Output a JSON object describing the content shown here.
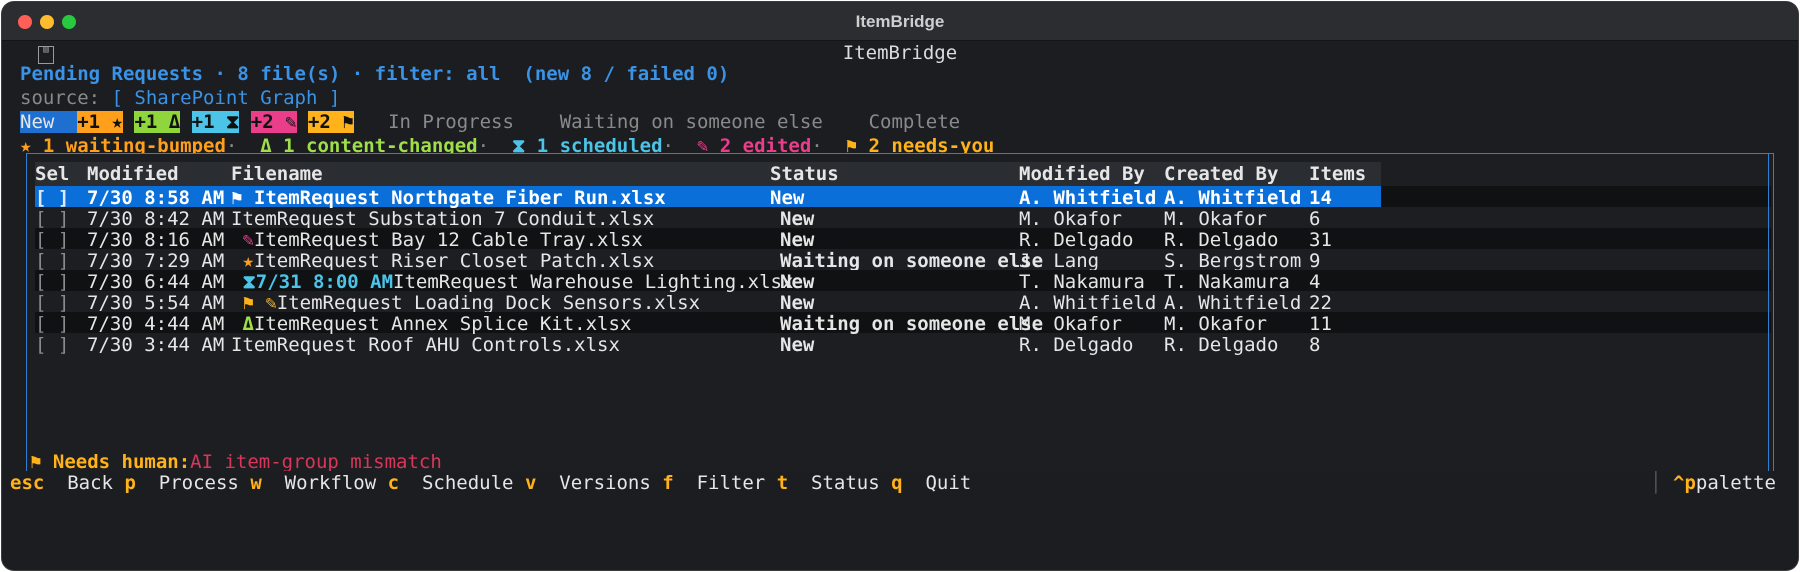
{
  "window": {
    "title": "ItemBridge"
  },
  "app": {
    "title": "ItemBridge",
    "header": {
      "title": "Pending Requests",
      "file_count": "8 file(s)",
      "filter": "filter: all",
      "counts": "(new 8 / failed 0)",
      "source_label": "source:",
      "source_value": "[ SharePoint Graph ]"
    },
    "tabs": {
      "new": "New",
      "chips": [
        {
          "label": "+1 ★",
          "color": "orange"
        },
        {
          "label": "+1 Δ",
          "color": "green"
        },
        {
          "label": "+1 ⧗",
          "color": "cyan"
        },
        {
          "label": "+2 ✎",
          "color": "pink"
        },
        {
          "label": "+2 ⚑",
          "color": "amber"
        }
      ],
      "others": [
        "In Progress",
        "Waiting on someone else",
        "Complete"
      ]
    },
    "legend": [
      {
        "text": "★ 1 waiting-bumped",
        "color": "orange"
      },
      {
        "text": "Δ 1 content-changed",
        "color": "green"
      },
      {
        "text": "⧗ 1 scheduled",
        "color": "cyan"
      },
      {
        "text": "✎ 2 edited",
        "color": "pink"
      },
      {
        "text": "⚑ 2 needs-you",
        "color": "amber"
      }
    ],
    "table": {
      "columns": [
        "Sel",
        "Modified",
        "Filename",
        "Status",
        "Modified By",
        "Created By",
        "Items"
      ],
      "rows": [
        {
          "sel": "[ ]",
          "modified": "7/30 8:58 AM",
          "prefix": "⚑ ",
          "prefix_type": "flag",
          "filename": "ItemRequest Northgate Fiber Run.xlsx",
          "status": "New",
          "modified_by": "A. Whitfield",
          "created_by": "A. Whitfield",
          "items": "14"
        },
        {
          "sel": "[ ]",
          "modified": "7/30 8:42 AM",
          "prefix": "",
          "prefix_type": "",
          "filename": "ItemRequest Substation 7 Conduit.xlsx",
          "status": "New",
          "modified_by": "M. Okafor",
          "created_by": "M. Okafor",
          "items": "6"
        },
        {
          "sel": "[ ]",
          "modified": "7/30 8:16 AM",
          "prefix": " ✎",
          "prefix_type": "edit",
          "filename": "ItemRequest Bay 12 Cable Tray.xlsx",
          "status": "New",
          "modified_by": "R. Delgado",
          "created_by": "R. Delgado",
          "items": "31"
        },
        {
          "sel": "[ ]",
          "modified": "7/30 7:29 AM",
          "prefix": " ★",
          "prefix_type": "star",
          "filename": "ItemRequest Riser Closet Patch.xlsx",
          "status": "Waiting on someone else",
          "modified_by": "J. Lang",
          "created_by": "S. Bergstrom",
          "items": "9"
        },
        {
          "sel": "[ ]",
          "modified": "7/30 6:44 AM",
          "prefix": " ⧗7/31 8:00 AM",
          "prefix_type": "sched",
          "filename": "ItemRequest Warehouse Lighting.xlsx",
          "status": "New",
          "modified_by": "T. Nakamura",
          "created_by": "T. Nakamura",
          "items": "4"
        },
        {
          "sel": "[ ]",
          "modified": "7/30 5:54 AM",
          "prefix": " ⚑ ✎",
          "prefix_type": "flag-edit",
          "filename": "ItemRequest Loading Dock Sensors.xlsx",
          "status": "New",
          "modified_by": "A. Whitfield",
          "created_by": "A. Whitfield",
          "items": "22"
        },
        {
          "sel": "[ ]",
          "modified": "7/30 4:44 AM",
          "prefix": " Δ",
          "prefix_type": "delta",
          "filename": "ItemRequest Annex Splice Kit.xlsx",
          "status": "Waiting on someone else",
          "modified_by": "M. Okafor",
          "created_by": "M. Okafor",
          "items": "11"
        },
        {
          "sel": "[ ]",
          "modified": "7/30 3:44 AM",
          "prefix": "",
          "prefix_type": "",
          "filename": "ItemRequest Roof AHU Controls.xlsx",
          "status": "New",
          "modified_by": "R. Delgado",
          "created_by": "R. Delgado",
          "items": "8"
        }
      ]
    },
    "note": {
      "label": "⚑ Needs human:",
      "text": "AI item-group mismatch"
    },
    "keybar": [
      {
        "key": "esc",
        "label": "Back"
      },
      {
        "key": "p",
        "label": "Process"
      },
      {
        "key": "w",
        "label": "Workflow"
      },
      {
        "key": "c",
        "label": "Schedule"
      },
      {
        "key": "v",
        "label": "Versions"
      },
      {
        "key": "f",
        "label": "Filter"
      },
      {
        "key": "t",
        "label": "Status"
      },
      {
        "key": "q",
        "label": "Quit"
      }
    ],
    "palette": {
      "key": "^p",
      "label": "palette"
    }
  }
}
